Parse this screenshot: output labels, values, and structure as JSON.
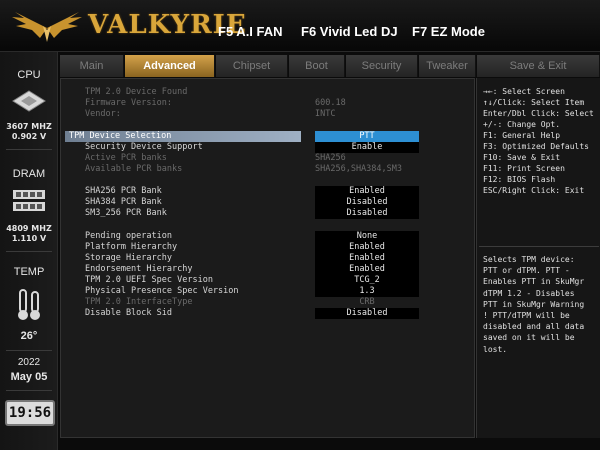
{
  "header": {
    "brand": "VALKYRIE",
    "f5_label": "F5 A.I FAN",
    "f6_label": "F6 Vivid Led DJ",
    "f7_label": "F7 EZ Mode",
    "accent_color": "#d9a63a"
  },
  "tabs": [
    {
      "label": "Main",
      "active": false
    },
    {
      "label": "Advanced",
      "active": true
    },
    {
      "label": "Chipset",
      "active": false
    },
    {
      "label": "Boot",
      "active": false
    },
    {
      "label": "Security",
      "active": false
    },
    {
      "label": "Tweaker",
      "active": false
    },
    {
      "label": "Save & Exit",
      "active": false
    }
  ],
  "status": {
    "cpu_label": "CPU",
    "cpu_freq": "3607 MHZ",
    "cpu_volt": "0.902 V",
    "dram_label": "DRAM",
    "dram_freq": "4809 MHZ",
    "dram_volt": "1.110 V",
    "temp_label": "TEMP",
    "temp_value": "26°",
    "year": "2022",
    "date": "May 05",
    "time": "19:56"
  },
  "settings": {
    "info": [
      {
        "label": "TPM 2.0 Device Found",
        "value": ""
      },
      {
        "label": "Firmware Version:",
        "value": "600.18"
      },
      {
        "label": "Vendor:",
        "value": "INTC"
      }
    ],
    "tpm_device_selection": {
      "label": "TPM Device Selection",
      "value": "PTT"
    },
    "security_device_support": {
      "label": "Security Device Support",
      "value": "Enable"
    },
    "active_pcr_banks": {
      "label": "Active PCR banks",
      "value": "SHA256"
    },
    "available_pcr_banks": {
      "label": "Available PCR banks",
      "value": "SHA256,SHA384,SM3"
    },
    "sha256_pcr_bank": {
      "label": "SHA256 PCR Bank",
      "value": "Enabled"
    },
    "sha384_pcr_bank": {
      "label": "SHA384 PCR Bank",
      "value": "Disabled"
    },
    "sm3_256_pcr_bank": {
      "label": "SM3_256 PCR Bank",
      "value": "Disabled"
    },
    "pending_operation": {
      "label": "Pending operation",
      "value": "None"
    },
    "platform_hierarchy": {
      "label": "Platform Hierarchy",
      "value": "Enabled"
    },
    "storage_hierarchy": {
      "label": "Storage Hierarchy",
      "value": "Enabled"
    },
    "endorsement_hierarchy": {
      "label": "Endorsement Hierarchy",
      "value": "Enabled"
    },
    "uefi_spec_version": {
      "label": "TPM 2.0 UEFI Spec Version",
      "value": "TCG_2"
    },
    "physical_presence_spec": {
      "label": "Physical Presence Spec Version",
      "value": "1.3"
    },
    "interface_type": {
      "label": "TPM 2.0 InterfaceType",
      "value": "CRB"
    },
    "disable_block_sid": {
      "label": "Disable Block Sid",
      "value": "Disabled"
    }
  },
  "help": {
    "keys": [
      "→←: Select Screen",
      "↑↓/Click: Select Item",
      "Enter/Dbl Click: Select",
      "+/-: Change Opt.",
      "F1: General Help",
      "F3: Optimized Defaults",
      "F10: Save & Exit",
      "F11: Print Screen",
      "F12: BIOS Flash",
      "ESC/Right Click: Exit"
    ],
    "description": [
      "Selects TPM device:",
      "PTT or dTPM. PTT -",
      "Enables PTT in SkuMgr",
      "dTPM 1.2 - Disables",
      "PTT in SkuMgr Warning",
      "!  PTT/dTPM will be",
      "disabled and all data",
      "saved on it will be",
      "lost."
    ]
  }
}
